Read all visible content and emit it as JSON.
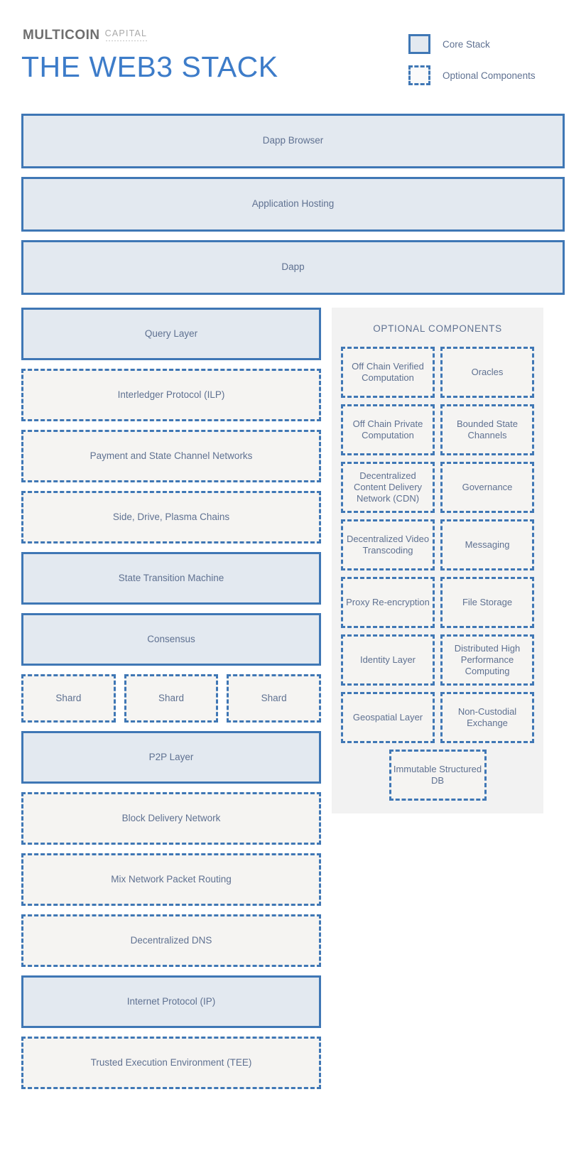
{
  "header": {
    "brand_main": "MULTICOIN",
    "brand_sub": "CAPITAL",
    "title": "THE WEB3 STACK"
  },
  "legend": {
    "items": [
      {
        "label": "Core Stack",
        "style": "solid"
      },
      {
        "label": "Optional Components",
        "style": "dashed"
      }
    ]
  },
  "colors": {
    "border_blue": "#3f77b5",
    "core_fill": "#e3e9f0",
    "optional_fill": "#f5f4f2",
    "text_blue": "#5f7191",
    "title_blue": "#3d7cc9",
    "panel_bg": "#f2f2f2"
  },
  "top_layers": [
    {
      "label": "Dapp Browser",
      "type": "core"
    },
    {
      "label": "Application Hosting",
      "type": "core"
    },
    {
      "label": "Dapp",
      "type": "core"
    }
  ],
  "left_column": [
    {
      "label": "Query Layer",
      "type": "core"
    },
    {
      "label": "Interledger Protocol (ILP)",
      "type": "optional"
    },
    {
      "label": "Payment and State Channel Networks",
      "type": "optional"
    },
    {
      "label": "Side, Drive, Plasma Chains",
      "type": "optional"
    },
    {
      "label": "State Transition Machine",
      "type": "core"
    },
    {
      "label": "Consensus",
      "type": "core"
    }
  ],
  "shards": [
    {
      "label": "Shard",
      "type": "optional"
    },
    {
      "label": "Shard",
      "type": "optional"
    },
    {
      "label": "Shard",
      "type": "optional"
    }
  ],
  "left_column_lower": [
    {
      "label": "P2P Layer",
      "type": "core"
    },
    {
      "label": "Block Delivery Network",
      "type": "optional"
    },
    {
      "label": "Mix Network Packet Routing",
      "type": "optional"
    },
    {
      "label": "Decentralized DNS",
      "type": "optional"
    },
    {
      "label": "Internet Protocol (IP)",
      "type": "core"
    },
    {
      "label": "Trusted Execution Environment (TEE)",
      "type": "optional"
    }
  ],
  "optional_panel": {
    "title": "OPTIONAL COMPONENTS",
    "items": [
      {
        "label": "Off Chain Verified Computation",
        "type": "optional"
      },
      {
        "label": "Oracles",
        "type": "optional"
      },
      {
        "label": "Off Chain Private Computation",
        "type": "optional"
      },
      {
        "label": "Bounded State Channels",
        "type": "optional"
      },
      {
        "label": "Decentralized Content Delivery Network (CDN)",
        "type": "optional"
      },
      {
        "label": "Governance",
        "type": "optional"
      },
      {
        "label": "Decentralized Video Transcoding",
        "type": "optional"
      },
      {
        "label": "Messaging",
        "type": "optional"
      },
      {
        "label": "Proxy Re-encryption",
        "type": "optional"
      },
      {
        "label": "File Storage",
        "type": "optional"
      },
      {
        "label": "Identity Layer",
        "type": "optional"
      },
      {
        "label": "Distributed High Performance Computing",
        "type": "optional"
      },
      {
        "label": "Geospatial Layer",
        "type": "optional"
      },
      {
        "label": "Non-Custodial Exchange",
        "type": "optional"
      }
    ],
    "last_item": {
      "label": "Immutable Structured DB",
      "type": "optional"
    }
  }
}
